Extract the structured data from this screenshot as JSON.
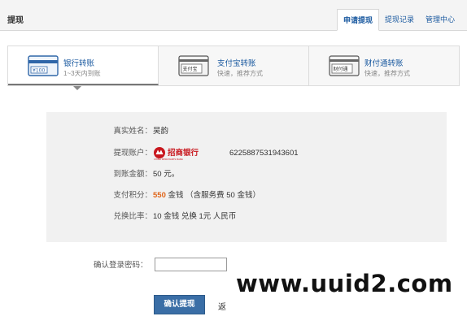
{
  "page": {
    "title": "提现"
  },
  "tabs": [
    {
      "label": "申请提现",
      "active": true
    },
    {
      "label": "提现记录",
      "active": false
    },
    {
      "label": "管理中心",
      "active": false
    }
  ],
  "methods": [
    {
      "title": "银行转账",
      "subtitle": "1~3天内到账",
      "icon": "bank-card-icon",
      "icon_text": "¥100",
      "active": true
    },
    {
      "title": "支付宝转账",
      "subtitle": "快速，推荐方式",
      "icon": "alipay-card-icon",
      "icon_text": "支付宝",
      "active": false
    },
    {
      "title": "财付通转账",
      "subtitle": "快速，推荐方式",
      "icon": "tenpay-card-icon",
      "icon_text": "财付通",
      "active": false
    }
  ],
  "info": {
    "name_label": "真实姓名：",
    "name_value": "吴韵",
    "account_label": "提现账户：",
    "bank_name": "招商银行",
    "bank_name_en": "CHINA MERCHANTS BANK",
    "account_number": "6225887531943601",
    "amount_label": "到账金额：",
    "amount_value": "50 元。",
    "points_label": "支付积分：",
    "points_value": "550",
    "points_suffix": "金钱 （含服务费 50 金钱）",
    "rate_label": "兑换比率：",
    "rate_value": "10 金钱 兑换 1元 人民币"
  },
  "password": {
    "label": "确认登录密码：",
    "value": ""
  },
  "actions": {
    "confirm_label": "确认提现",
    "back_label": "返"
  },
  "watermark": "www.uuid2.com",
  "colors": {
    "link": "#1b5aa0",
    "accent": "#e0661b",
    "button": "#3a6ea6",
    "bank_red": "#c8161d"
  }
}
